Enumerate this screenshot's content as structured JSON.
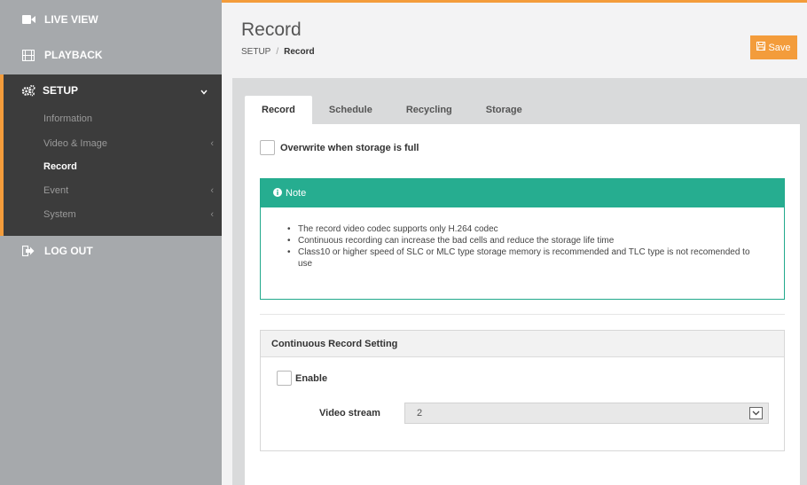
{
  "sidebar": {
    "live_view": "LIVE VIEW",
    "playback": "PLAYBACK",
    "setup": "SETUP",
    "setup_items": [
      {
        "label": "Information"
      },
      {
        "label": "Video & Image"
      },
      {
        "label": "Record"
      },
      {
        "label": "Event"
      },
      {
        "label": "System"
      }
    ],
    "logout": "LOG OUT"
  },
  "header": {
    "title": "Record",
    "breadcrumb_root": "SETUP",
    "breadcrumb_sep": "/",
    "breadcrumb_current": "Record",
    "save_label": "Save"
  },
  "tabs": [
    {
      "label": "Record"
    },
    {
      "label": "Schedule"
    },
    {
      "label": "Recycling"
    },
    {
      "label": "Storage"
    }
  ],
  "record": {
    "overwrite_label": "Overwrite when storage is full",
    "note_title": "Note",
    "notes": [
      "The record video codec supports only H.264 codec",
      "Continuous recording can increase the bad cells and reduce the storage life time",
      "Class10 or higher speed of SLC or MLC type storage memory is recommended and TLC type is not recomended to use"
    ],
    "continuous_title": "Continuous Record Setting",
    "enable_label": "Enable",
    "video_stream_label": "Video stream",
    "video_stream_value": "2"
  },
  "colors": {
    "accent": "#f39c3b",
    "note": "#26ad90",
    "sidebar": "#a6a9ac",
    "sidebar_active": "#3c3c3c"
  }
}
